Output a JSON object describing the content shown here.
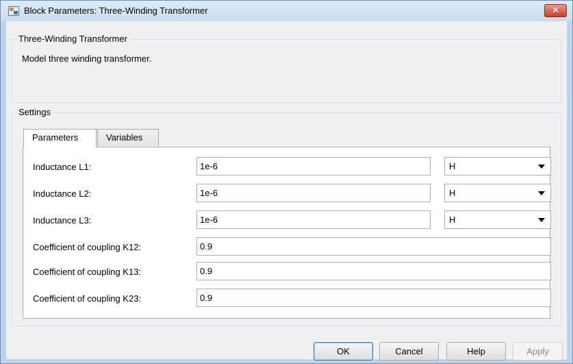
{
  "window": {
    "title": "Block Parameters: Three-Winding Transformer",
    "close_label": "✕"
  },
  "block": {
    "heading": "Three-Winding Transformer",
    "description": "Model three winding transformer."
  },
  "settings": {
    "heading": "Settings",
    "tabs": [
      {
        "label": "Parameters",
        "active": true
      },
      {
        "label": "Variables",
        "active": false
      }
    ],
    "rows": [
      {
        "label": "Inductance L1:",
        "value": "1e-6",
        "unit": "H"
      },
      {
        "label": "Inductance L2:",
        "value": "1e-6",
        "unit": "H"
      },
      {
        "label": "Inductance L3:",
        "value": "1e-6",
        "unit": "H"
      },
      {
        "label": "Coefficient of coupling K12:",
        "value": "0.9"
      },
      {
        "label": "Coefficient of coupling K13:",
        "value": "0.9"
      },
      {
        "label": "Coefficient of coupling K23:",
        "value": "0.9"
      }
    ]
  },
  "buttons": {
    "ok": "OK",
    "cancel": "Cancel",
    "help": "Help",
    "apply": "Apply"
  }
}
